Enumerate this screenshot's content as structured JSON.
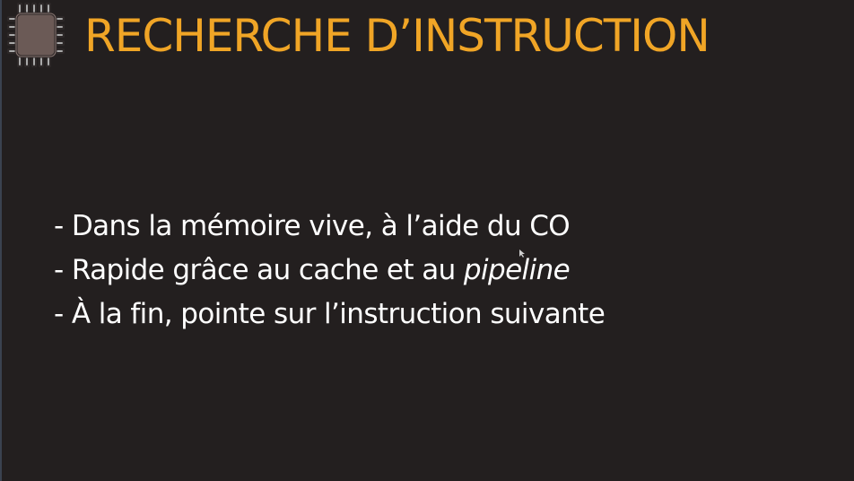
{
  "slide": {
    "title": "RECHERCHE D’INSTRUCTION",
    "icon": "cpu-chip-icon",
    "bullets": [
      {
        "text": "- Dans la mémoire vive, à l’aide du CO",
        "emphasis": ""
      },
      {
        "text": "- Rapide grâce au cache et au ",
        "emphasis": "pipeline"
      },
      {
        "text": "- À la fin, pointe sur l’instruction suivante",
        "emphasis": ""
      }
    ]
  },
  "colors": {
    "background": "#231f1f",
    "title": "#f0a526",
    "text": "#ffffff"
  }
}
